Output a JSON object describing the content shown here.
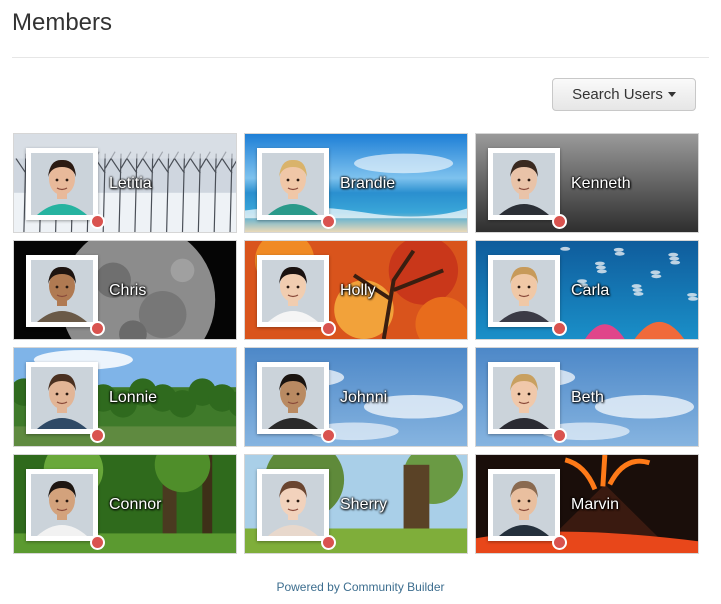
{
  "page": {
    "title": "Members"
  },
  "toolbar": {
    "search_label": "Search Users"
  },
  "members": [
    {
      "name": "Letitia",
      "status": "offline",
      "scene": "snow",
      "skin": "#e8b99a",
      "hair": "#2b1a12",
      "shirt": "#26b3a0"
    },
    {
      "name": "Brandie",
      "status": "offline",
      "scene": "beach",
      "skin": "#f0c7a7",
      "hair": "#d9b36b",
      "shirt": "#2a9a8a"
    },
    {
      "name": "Kenneth",
      "status": "offline",
      "scene": "gray",
      "skin": "#e9c3a8",
      "hair": "#3a2a20",
      "shirt": "#2b2f36"
    },
    {
      "name": "Chris",
      "status": "offline",
      "scene": "moon",
      "skin": "#b07a52",
      "hair": "#1e1410",
      "shirt": "#6a5a48"
    },
    {
      "name": "Holly",
      "status": "offline",
      "scene": "autumn",
      "skin": "#f1cdb0",
      "hair": "#1a1210",
      "shirt": "#f5f5f5"
    },
    {
      "name": "Carla",
      "status": "offline",
      "scene": "reef",
      "skin": "#f0c8a6",
      "hair": "#c79a5a",
      "shirt": "#3b3b46"
    },
    {
      "name": "Lonnie",
      "status": "offline",
      "scene": "forest",
      "skin": "#e2b596",
      "hair": "#4a3020",
      "shirt": "#2f4a66"
    },
    {
      "name": "Johnni",
      "status": "offline",
      "scene": "sky",
      "skin": "#b98a62",
      "hair": "#1a1410",
      "shirt": "#2a2a2a"
    },
    {
      "name": "Beth",
      "status": "offline",
      "scene": "sky",
      "skin": "#f0c8aa",
      "hair": "#c8a060",
      "shirt": "#2b2b33"
    },
    {
      "name": "Connor",
      "status": "offline",
      "scene": "green",
      "skin": "#d3a27c",
      "hair": "#1e1612",
      "shirt": "#f2f2f2"
    },
    {
      "name": "Sherry",
      "status": "offline",
      "scene": "tree",
      "skin": "#f2d2bc",
      "hair": "#6a4530",
      "shirt": "#e8d8cc"
    },
    {
      "name": "Marvin",
      "status": "offline",
      "scene": "volcano",
      "skin": "#e9bf9f",
      "hair": "#8a6a50",
      "shirt": "#24303c"
    }
  ],
  "footer": {
    "text": "Powered by Community Builder"
  },
  "colors": {
    "status_offline": "#d9534f",
    "link": "#3d6e8f"
  }
}
